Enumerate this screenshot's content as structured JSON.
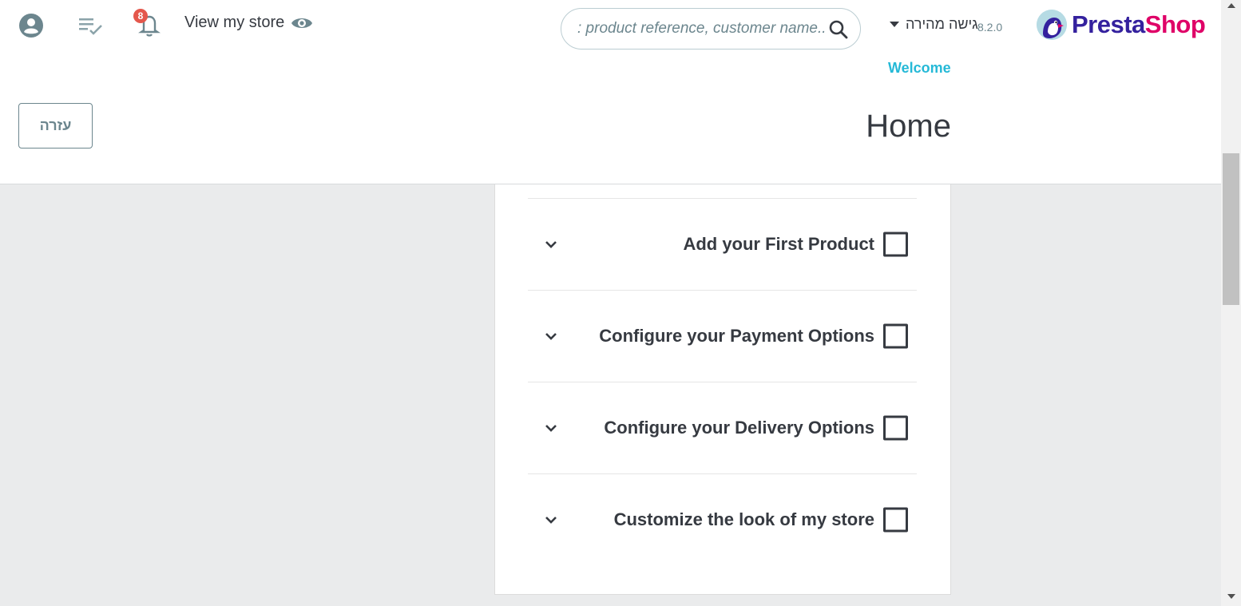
{
  "header": {
    "view_store_label": "View my store",
    "notifications_count": "8",
    "search_placeholder": ": product reference, customer name...)",
    "quick_access_label": "גישה מהירה",
    "version": "8.2.0",
    "logo_presta": "Presta",
    "logo_shop": "Shop",
    "welcome_label": "Welcome",
    "help_label": "עזרה",
    "page_title": "Home"
  },
  "steps": [
    {
      "label": "Add your First Product",
      "checked": false
    },
    {
      "label": "Configure your Payment Options",
      "checked": false
    },
    {
      "label": "Configure your Delivery Options",
      "checked": false
    },
    {
      "label": "Customize the look of my store",
      "checked": false
    }
  ],
  "icons": {
    "user": "user-circle-icon",
    "orders": "playlist-check-icon",
    "notifications": "bell-icon",
    "view_store": "eye-icon",
    "search": "search-icon",
    "expand": "chevron-down-icon"
  },
  "colors": {
    "accent": "#25b9d7",
    "badge": "#e4574c",
    "brand_presta": "#34219e",
    "brand_shop": "#df0067",
    "text": "#363a41",
    "muted": "#6c868e"
  }
}
